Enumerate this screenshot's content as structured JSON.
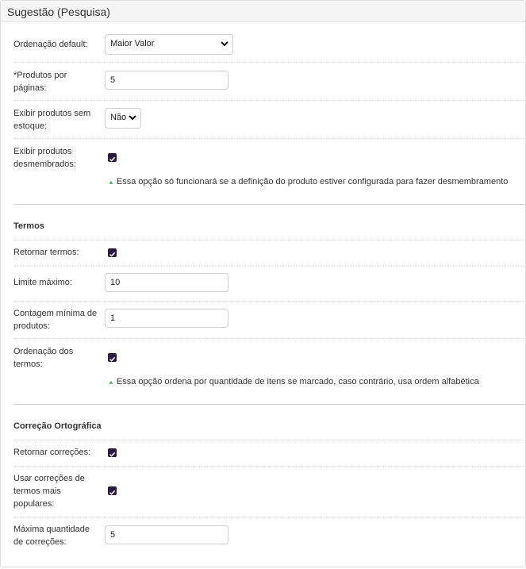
{
  "panel": {
    "title": "Sugestão (Pesquisa)"
  },
  "fields": {
    "ordenacao_default": {
      "label": "Ordenação default:",
      "value": "Maior Valor"
    },
    "produtos_por_pagina": {
      "label": "*Produtos por páginas:",
      "value": "5"
    },
    "exibir_sem_estoque": {
      "label": "Exibir produtos sem estoque:",
      "value": "Não"
    },
    "exibir_desmembrados": {
      "label": "Exibir produtos desmembrados:",
      "checked": true,
      "hint": "Essa opção só funcionará se a definição do produto estiver configurada para fazer desmembramento"
    }
  },
  "termos": {
    "title": "Termos",
    "retornar": {
      "label": "Retornar termos:",
      "checked": true
    },
    "limite": {
      "label": "Limite máximo:",
      "value": "10"
    },
    "contagem": {
      "label": "Contagem mínima de produtos:",
      "value": "1"
    },
    "ordenacao": {
      "label": "Ordenação dos termos:",
      "checked": true,
      "hint": "Essa opção ordena por quantidade de itens se marcado, caso contrário, usa ordem alfabética"
    }
  },
  "correcao": {
    "title": "Correção Ortográfica",
    "retornar": {
      "label": "Retornar correções:",
      "checked": true
    },
    "usar_populares": {
      "label": "Usar correções de termos mais populares:",
      "checked": true
    },
    "maxima": {
      "label": "Máxima quantidade de correções:",
      "value": "5"
    }
  },
  "icons": {
    "checkbox": "checkbox-checked-icon",
    "chevron": "chevron-down-icon",
    "hint": "arrow-up-icon"
  },
  "colors": {
    "checkbox": "#2b1a40",
    "hint_arrow": "#5bb85d"
  }
}
